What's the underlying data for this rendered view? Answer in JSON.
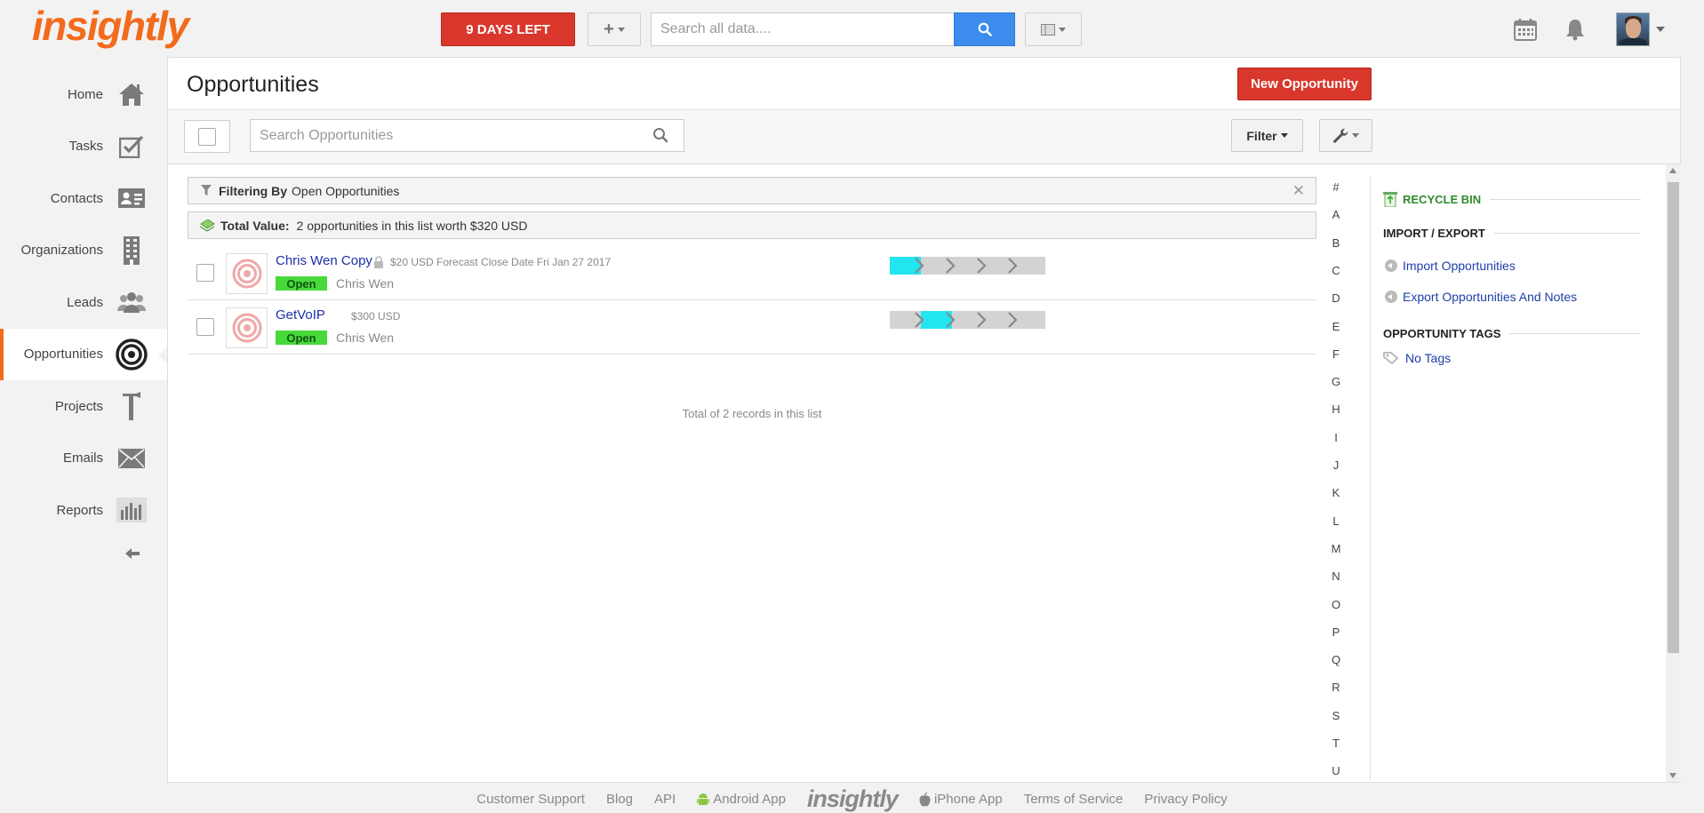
{
  "app": {
    "logo_text": "insightly",
    "trial_label": "9 DAYS LEFT",
    "search_placeholder": "Search all data....",
    "brand_color": "#f26b1d",
    "accent_red": "#d9372b",
    "accent_blue": "#3b8ced"
  },
  "sidebar": {
    "items": [
      {
        "label": "Home",
        "icon": "home-icon"
      },
      {
        "label": "Tasks",
        "icon": "tasks-icon"
      },
      {
        "label": "Contacts",
        "icon": "contacts-icon"
      },
      {
        "label": "Organizations",
        "icon": "organizations-icon"
      },
      {
        "label": "Leads",
        "icon": "leads-icon"
      },
      {
        "label": "Opportunities",
        "icon": "opportunities-icon",
        "active": true
      },
      {
        "label": "Projects",
        "icon": "projects-icon"
      },
      {
        "label": "Emails",
        "icon": "emails-icon"
      },
      {
        "label": "Reports",
        "icon": "reports-icon"
      }
    ]
  },
  "page": {
    "title": "Opportunities",
    "new_button": "New Opportunity",
    "search_placeholder": "Search Opportunities",
    "filter_button": "Filter"
  },
  "filter_bar": {
    "label": "Filtering By",
    "value": "Open Opportunities"
  },
  "total_bar": {
    "label": "Total Value:",
    "value": "2 opportunities in this list worth $320 USD"
  },
  "opportunities": [
    {
      "name": "Chris Wen Copy",
      "meta": "$20 USD Forecast Close Date Fri Jan 27 2017",
      "private": true,
      "status": "Open",
      "owner": "Chris Wen",
      "pipeline_stage": 1,
      "pipeline_total": 5
    },
    {
      "name": "GetVoIP",
      "meta": "$300 USD",
      "private": false,
      "status": "Open",
      "owner": "Chris Wen",
      "pipeline_stage": 2,
      "pipeline_total": 5
    }
  ],
  "records_total": "Total of 2 records in this list",
  "alphabet": [
    "#",
    "A",
    "B",
    "C",
    "D",
    "E",
    "F",
    "G",
    "H",
    "I",
    "J",
    "K",
    "L",
    "M",
    "N",
    "O",
    "P",
    "Q",
    "R",
    "S",
    "T",
    "U"
  ],
  "right_panel": {
    "recycle_bin": "RECYCLE BIN",
    "import_export_heading": "IMPORT / EXPORT",
    "import_link": "Import Opportunities",
    "export_link": "Export Opportunities And Notes",
    "tags_heading": "OPPORTUNITY TAGS",
    "no_tags": "No Tags"
  },
  "footer": {
    "customer_support": "Customer Support",
    "blog": "Blog",
    "api": "API",
    "android_app": "Android App",
    "logo_text": "insightly",
    "iphone_app": "iPhone App",
    "terms": "Terms of Service",
    "privacy": "Privacy Policy"
  }
}
